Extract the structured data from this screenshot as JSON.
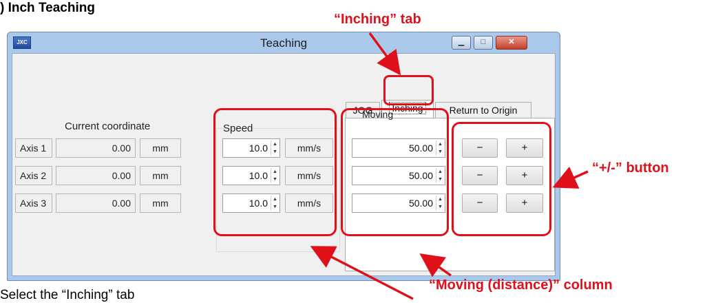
{
  "doc": {
    "heading": ") Inch Teaching",
    "caption": "Select the “Inching” tab"
  },
  "callouts": {
    "inching_tab": "“Inching” tab",
    "pm_button": "“+/-” button",
    "moving_column": "“Moving (distance)” column"
  },
  "window": {
    "app_icon": "JXC",
    "title": "Teaching",
    "min_icon": "minimize-icon",
    "max_icon": "maximize-icon",
    "close_icon": "close-icon"
  },
  "coordinates": {
    "header": "Current coordinate",
    "rows": [
      {
        "axis": "Axis 1",
        "value": "0.00",
        "unit": "mm"
      },
      {
        "axis": "Axis 2",
        "value": "0.00",
        "unit": "mm"
      },
      {
        "axis": "Axis 3",
        "value": "0.00",
        "unit": "mm"
      }
    ]
  },
  "speed": {
    "header": "Speed",
    "rows": [
      {
        "value": "10.0",
        "unit": "mm/s"
      },
      {
        "value": "10.0",
        "unit": "mm/s"
      },
      {
        "value": "10.0",
        "unit": "mm/s"
      }
    ]
  },
  "tabs": [
    {
      "label": "JOG",
      "active": false
    },
    {
      "label": "Inching",
      "active": true
    },
    {
      "label": "Return to Origin",
      "active": false
    }
  ],
  "moving": {
    "header": "Moving",
    "rows": [
      {
        "value": "50.00"
      },
      {
        "value": "50.00"
      },
      {
        "value": "50.00"
      }
    ]
  },
  "buttons": {
    "minus": "−",
    "plus": "+"
  },
  "colors": {
    "callout_red": "#e0101a",
    "window_frame": "#a9c8ea"
  }
}
